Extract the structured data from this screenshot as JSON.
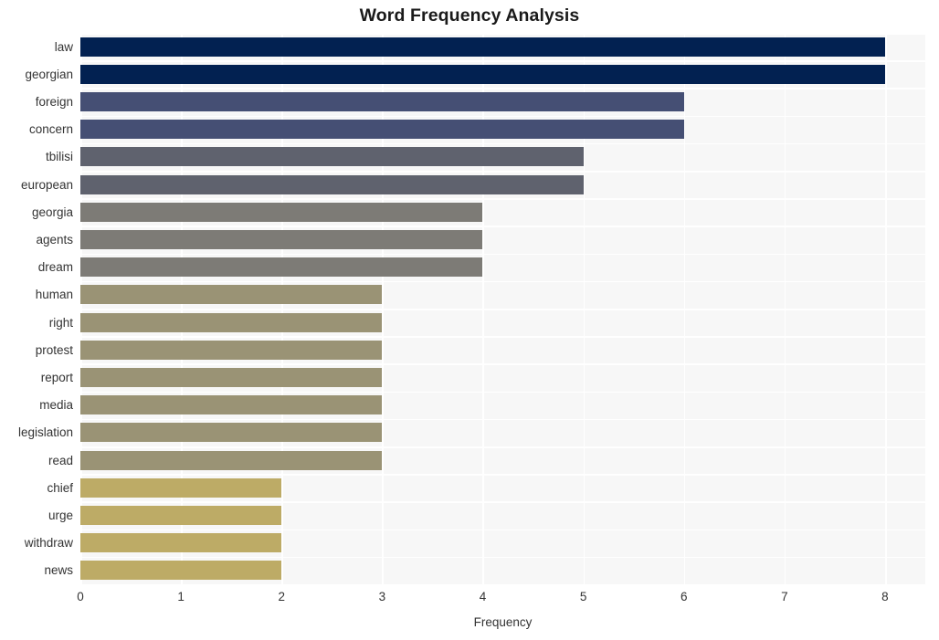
{
  "chart_data": {
    "type": "bar",
    "orientation": "horizontal",
    "title": "Word Frequency Analysis",
    "xlabel": "Frequency",
    "ylabel": "",
    "xlim": [
      0,
      8.4
    ],
    "xticks": [
      0,
      1,
      2,
      3,
      4,
      5,
      6,
      7,
      8
    ],
    "xtick_labels": [
      "0",
      "1",
      "2",
      "3",
      "4",
      "5",
      "6",
      "7",
      "8"
    ],
    "grid": true,
    "legend": false,
    "categories": [
      "law",
      "georgian",
      "foreign",
      "concern",
      "tbilisi",
      "european",
      "georgia",
      "agents",
      "dream",
      "human",
      "right",
      "protest",
      "report",
      "media",
      "legislation",
      "read",
      "chief",
      "urge",
      "withdraw",
      "news"
    ],
    "values": [
      8,
      8,
      6,
      6,
      5,
      5,
      4,
      4,
      4,
      3,
      3,
      3,
      3,
      3,
      3,
      3,
      2,
      2,
      2,
      2
    ],
    "bar_colors": [
      "#022151",
      "#022151",
      "#454f74",
      "#454f74",
      "#5f626e",
      "#5f626e",
      "#7d7b76",
      "#7d7b76",
      "#7d7b76",
      "#9a9375",
      "#9a9375",
      "#9a9375",
      "#9a9375",
      "#9a9375",
      "#9a9375",
      "#9a9375",
      "#bdab66",
      "#bdab66",
      "#bdab66",
      "#bdab66"
    ],
    "plot_background": "#f7f7f7",
    "grid_color": "#ffffff",
    "figure_background": "#ffffff"
  }
}
